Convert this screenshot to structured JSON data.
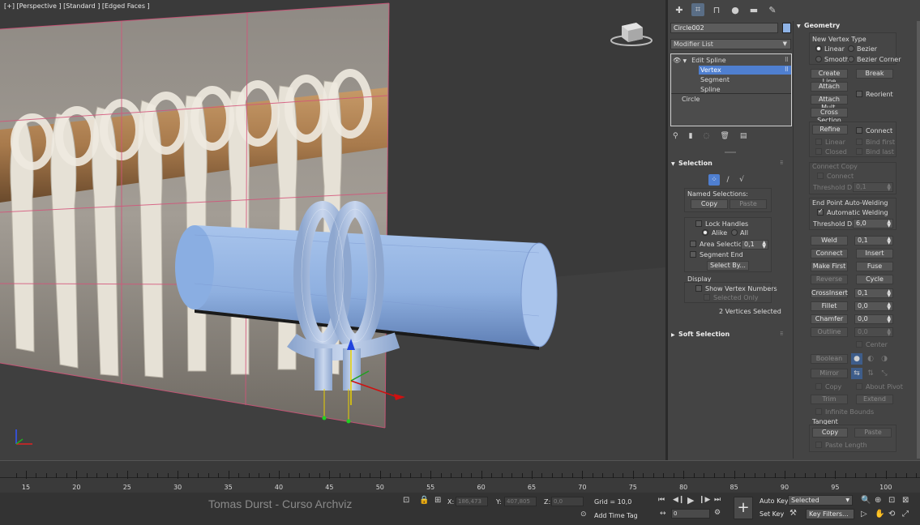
{
  "viewport": {
    "label": "[+] [Perspective ] [Standard ] [Edged Faces ]"
  },
  "command_panel": {
    "tabs": [
      "create-icon",
      "modify-icon",
      "hierarchy-icon",
      "motion-icon",
      "display-icon",
      "utilities-icon"
    ],
    "object_name": "Circle002",
    "object_color": "#8fb3e6",
    "modifier_list_label": "Modifier List",
    "stack": {
      "edit_spline": "Edit Spline",
      "vertex": "Vertex",
      "segment": "Segment",
      "spline": "Spline",
      "circle": "Circle"
    }
  },
  "selection": {
    "title": "Selection",
    "named_selections": "Named Selections:",
    "copy": "Copy",
    "paste": "Paste",
    "lock_handles": "Lock Handles",
    "alike": "Alike",
    "all": "All",
    "area_selection": "Area Selection:",
    "area_value": "0,1",
    "segment_end": "Segment End",
    "select_by": "Select By...",
    "display": "Display",
    "show_vertex_numbers": "Show Vertex Numbers",
    "selected_only": "Selected Only",
    "status": "2 Vertices Selected"
  },
  "soft_selection": {
    "title": "Soft Selection"
  },
  "geometry": {
    "title": "Geometry",
    "new_vertex_type": "New Vertex Type",
    "linear": "Linear",
    "bezier": "Bezier",
    "smooth": "Smooth",
    "bezier_corner": "Bezier Corner",
    "create_line": "Create Line",
    "break": "Break",
    "attach": "Attach",
    "reorient": "Reorient",
    "attach_mult": "Attach Mult.",
    "cross_section": "Cross Section",
    "refine": "Refine",
    "connect": "Connect",
    "linear2": "Linear",
    "bind_first": "Bind first",
    "closed": "Closed",
    "bind_last": "Bind last",
    "connect_copy": "Connect Copy",
    "connect2": "Connect",
    "threshold_dist": "Threshold Dist",
    "threshold_value1": "0,1",
    "end_point_auto_welding": "End Point Auto-Welding",
    "automatic_welding": "Automatic Welding",
    "threshold_value2": "6,0",
    "weld": "Weld",
    "weld_value": "0,1",
    "connect3": "Connect",
    "insert": "Insert",
    "make_first": "Make First",
    "fuse": "Fuse",
    "reverse": "Reverse",
    "cycle": "Cycle",
    "crossinsert": "CrossInsert",
    "crossinsert_value": "0,1",
    "fillet": "Fillet",
    "fillet_value": "0,0",
    "chamfer": "Chamfer",
    "chamfer_value": "0,0",
    "outline": "Outline",
    "outline_value": "0,0",
    "center": "Center",
    "boolean": "Boolean",
    "mirror": "Mirror",
    "copy": "Copy",
    "about_pivot": "About Pivot",
    "trim": "Trim",
    "extend": "Extend",
    "infinite_bounds": "Infinite Bounds",
    "tangent": "Tangent",
    "tangent_copy": "Copy",
    "tangent_paste": "Paste",
    "paste_length": "Paste Length"
  },
  "timeline": {
    "labels": [
      "15",
      "20",
      "25",
      "30",
      "35",
      "40",
      "45",
      "50",
      "55",
      "60",
      "65",
      "70",
      "75",
      "80",
      "85",
      "90",
      "95",
      "100"
    ]
  },
  "status_bar": {
    "brand": "Tomas Durst - Curso Archviz",
    "x_label": "X:",
    "x_value": "186,473",
    "y_label": "Y:",
    "y_value": "407,805",
    "z_label": "Z:",
    "z_value": "0,0",
    "grid": "Grid = 10,0",
    "add_time_tag": "Add Time Tag",
    "frame_value": "0",
    "auto_key": "Auto Key",
    "set_key": "Set Key",
    "key_mode": "Selected",
    "key_filters": "Key Filters..."
  }
}
